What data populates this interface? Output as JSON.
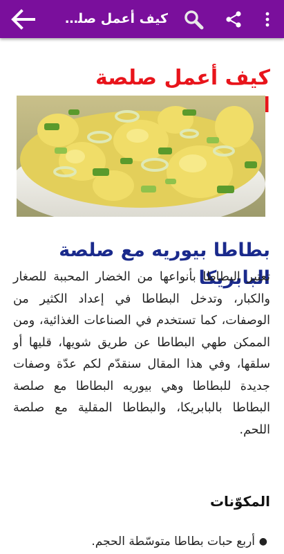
{
  "app_bar": {
    "title": "كيف أعمل صلص...",
    "icons": {
      "back": "arrow-back-icon",
      "search": "search-icon",
      "share": "share-icon",
      "menu": "more-vert-icon"
    },
    "background": "#7a0f9c"
  },
  "article": {
    "title": "كيف أعمل صلصة البطاطس",
    "hero_image": "potato-salad-photo",
    "section_title": "بطاطا بيوريه مع صلصة البابريكا",
    "intro": "تعتبر البطاطا بأنواعها من الخضار المحببة للصغار والكبار، وتدخل البطاطا في إعداد الكثير من الوصفات، كما تستخدم في الصناعات الغذائية، ومن الممكن طهي البطاطا عن طريق شويها، قليها أو سلقها، وفي هذا المقال سنقدّم لكم عدّة وصفات جديدة للبطاطا وهي بيوريه البطاطا مع صلصة البطاطا بالبابريكا، والبطاطا المقلية مع صلصة اللحم.",
    "ingredients_title": "المكوّنات",
    "ingredients": [
      "أربع حبات بطاطا متوسّطة الحجم."
    ],
    "colors": {
      "title": "#e8141b",
      "section_title": "#1a2a8c"
    }
  }
}
